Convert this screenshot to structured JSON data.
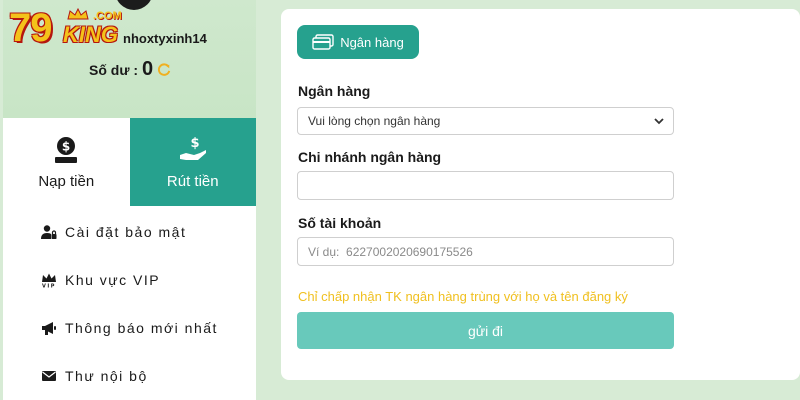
{
  "brand": {
    "logo_number": "79",
    "logo_word": "KING",
    "logo_suffix": ".COM"
  },
  "profile": {
    "username": "nhoxtyxinh14",
    "balance_label": "Số dư :",
    "balance_value": "0"
  },
  "tabs": [
    {
      "label": "Nạp tiền",
      "icon": "money-bag-icon",
      "active": false
    },
    {
      "label": "Rút tiền",
      "icon": "hand-dollar-icon",
      "active": true
    }
  ],
  "menu": [
    {
      "label": "Cài đặt bảo mật",
      "icon": "user-lock-icon"
    },
    {
      "label": "Khu vực VIP",
      "icon": "vip-crown-icon"
    },
    {
      "label": "Thông báo mới nhất",
      "icon": "megaphone-icon"
    },
    {
      "label": "Thư nội bộ",
      "icon": "envelope-icon"
    }
  ],
  "form": {
    "method_tab_label": "Ngân hàng",
    "bank_label": "Ngân hàng",
    "bank_select_value": "Vui lòng chọn ngân hàng",
    "branch_label": "Chi nhánh ngân hàng",
    "branch_value": "",
    "account_label": "Số tài khoản",
    "account_placeholder": "Ví dụ:  6227002020690175526",
    "note": "Chỉ chấp nhận TK ngân hàng trùng với họ và tên đăng ký",
    "submit_label": "gửi đi"
  },
  "colors": {
    "accent": "#26a18e",
    "submit": "#68c9bb",
    "note": "#f0c020",
    "background": "#d7ebd5"
  }
}
